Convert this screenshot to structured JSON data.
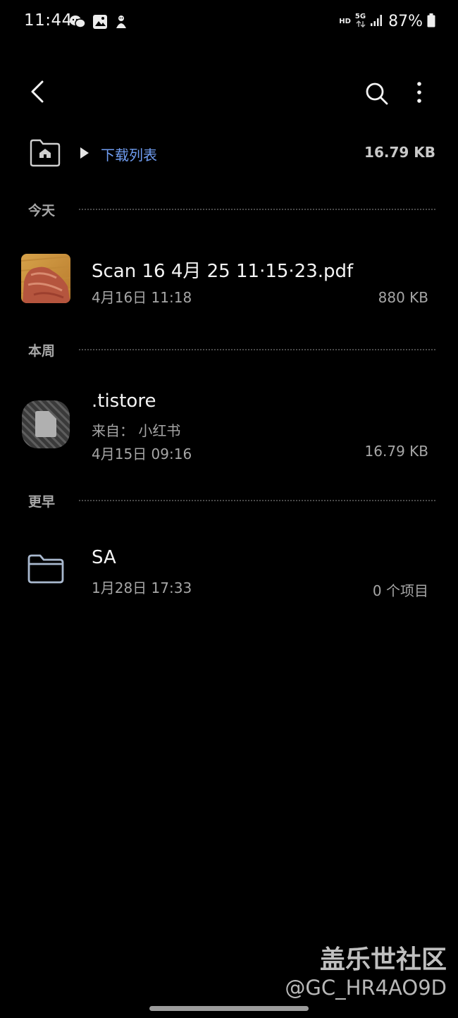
{
  "status_bar": {
    "time": "11:44",
    "icons": [
      "wechat-icon",
      "gallery-icon",
      "app-icon"
    ],
    "hd": "HD",
    "network": "5G",
    "battery": "87%"
  },
  "toolbar": {
    "back_icon": "chevron-left-icon",
    "search_icon": "search-icon",
    "more_icon": "more-vertical-icon"
  },
  "path": {
    "home_icon": "home-folder-icon",
    "current": "下载列表",
    "total_size": "16.79 KB"
  },
  "sections": [
    {
      "label": "今天",
      "items": [
        {
          "name": "Scan 16 4月 25 11·15·23.pdf",
          "date": "4月16日 11:18",
          "size": "880 KB",
          "icon": "pdf-thumbnail"
        }
      ]
    },
    {
      "label": "本周",
      "items": [
        {
          "name": ".tistore",
          "source": "来自： 小红书",
          "date": "4月15日 09:16",
          "size": "16.79 KB",
          "icon": "unknown-file-icon"
        }
      ]
    },
    {
      "label": "更早",
      "items": [
        {
          "name": "SA",
          "date": "1月28日 17:33",
          "size": "0 个项目",
          "icon": "folder-icon"
        }
      ]
    }
  ],
  "watermark": {
    "title": "盖乐世社区",
    "id": "@GC_HR4AO9D"
  },
  "colors": {
    "background": "#000000",
    "accent": "#6f9cf0",
    "text_primary": "#f4f4f4",
    "text_secondary": "#a6a6a6"
  }
}
